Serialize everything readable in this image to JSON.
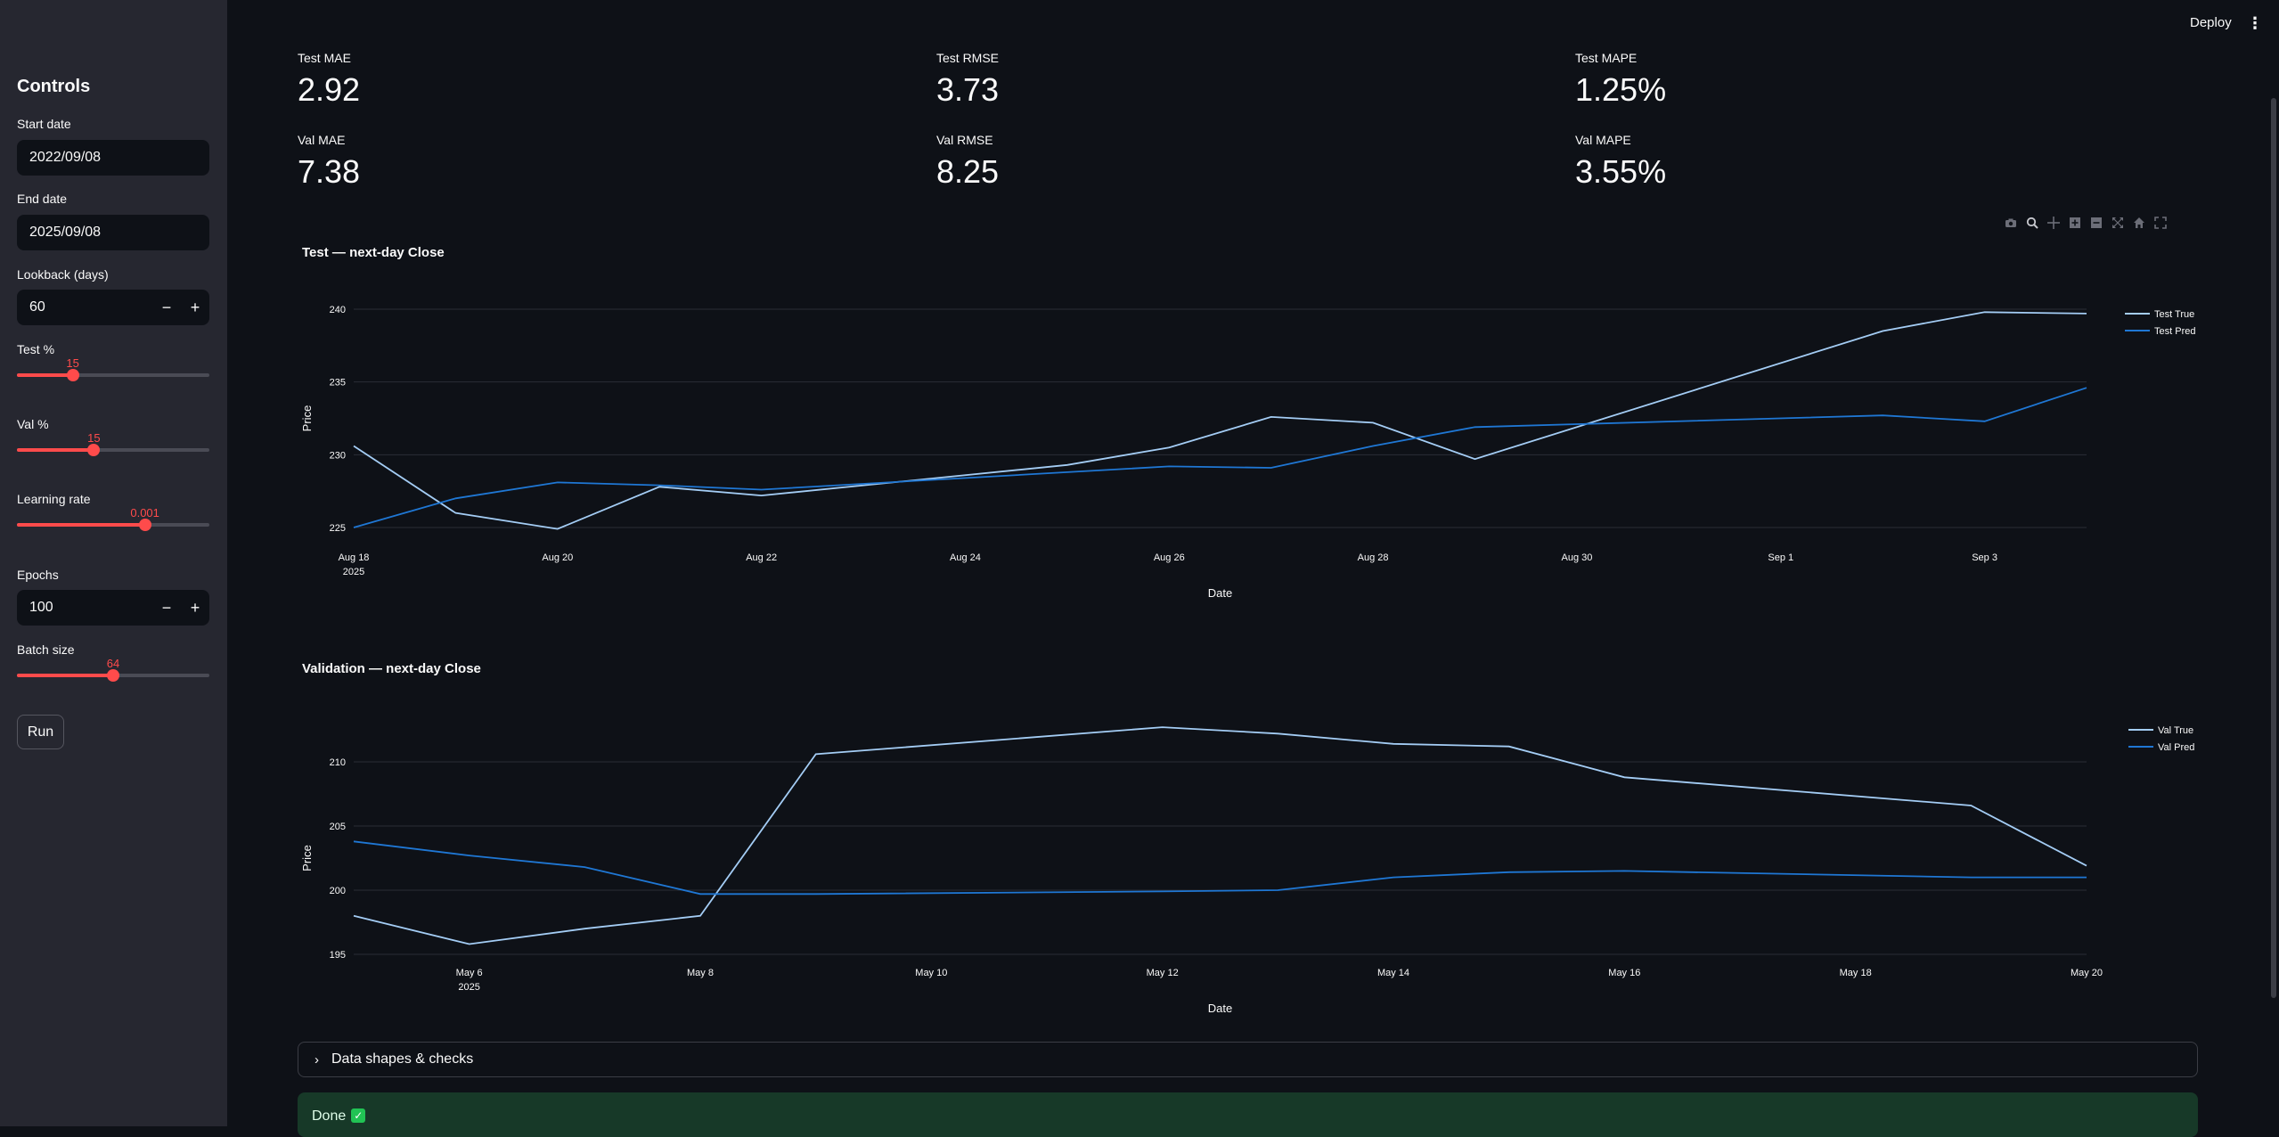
{
  "header": {
    "deploy_label": "Deploy",
    "menu_icon": "kebab-menu-icon"
  },
  "sidebar": {
    "title": "Controls",
    "start_date": {
      "label": "Start date",
      "value": "2022/09/08"
    },
    "end_date": {
      "label": "End date",
      "value": "2025/09/08"
    },
    "lookback": {
      "label": "Lookback (days)",
      "value": "60",
      "minus": "−",
      "plus": "+"
    },
    "test_pct": {
      "label": "Test %",
      "value": "15",
      "fraction": 0.29
    },
    "val_pct": {
      "label": "Val %",
      "value": "15",
      "fraction": 0.4
    },
    "learning_rate": {
      "label": "Learning rate",
      "value": "0.001",
      "fraction": 0.665
    },
    "epochs": {
      "label": "Epochs",
      "value": "100",
      "minus": "−",
      "plus": "+"
    },
    "batch_size": {
      "label": "Batch size",
      "value": "64",
      "fraction": 0.5
    },
    "run_label": "Run"
  },
  "metrics": [
    {
      "label": "Test MAE",
      "value": "2.92"
    },
    {
      "label": "Test RMSE",
      "value": "3.73"
    },
    {
      "label": "Test MAPE",
      "value": "1.25%"
    },
    {
      "label": "Val MAE",
      "value": "7.38"
    },
    {
      "label": "Val RMSE",
      "value": "8.25"
    },
    {
      "label": "Val MAPE",
      "value": "3.55%"
    }
  ],
  "chart_toolbar": [
    "camera-icon",
    "zoom-icon",
    "pan-icon",
    "zoom-in-icon",
    "zoom-out-icon",
    "autoscale-icon",
    "home-icon",
    "fullscreen-icon"
  ],
  "chart_data": [
    {
      "type": "line",
      "title": "Test — next-day Close",
      "xlabel": "Date",
      "ylabel": "Price",
      "ylim": [
        225,
        240
      ],
      "yticks": [
        225,
        230,
        235,
        240
      ],
      "xlim": [
        "2025-08-18",
        "2025-09-04"
      ],
      "xtick_labels": [
        "Aug 18",
        "Aug 20",
        "Aug 22",
        "Aug 24",
        "Aug 26",
        "Aug 28",
        "Aug 30",
        "Sep 1",
        "Sep 3"
      ],
      "xtick_year": "2025",
      "legend_position": "top-right",
      "series": [
        {
          "name": "Test True",
          "color": "#a4cdf5",
          "x": [
            "2025-08-18",
            "2025-08-19",
            "2025-08-20",
            "2025-08-21",
            "2025-08-22",
            "2025-08-25",
            "2025-08-26",
            "2025-08-27",
            "2025-08-28",
            "2025-08-29",
            "2025-09-02",
            "2025-09-03",
            "2025-09-04"
          ],
          "y": [
            230.6,
            226.0,
            224.9,
            227.8,
            227.2,
            229.3,
            230.5,
            232.6,
            232.2,
            229.7,
            238.5,
            239.8,
            239.7
          ]
        },
        {
          "name": "Test Pred",
          "color": "#1f77d4",
          "x": [
            "2025-08-18",
            "2025-08-19",
            "2025-08-20",
            "2025-08-21",
            "2025-08-22",
            "2025-08-25",
            "2025-08-26",
            "2025-08-27",
            "2025-08-28",
            "2025-08-29",
            "2025-09-02",
            "2025-09-03",
            "2025-09-04"
          ],
          "y": [
            225.0,
            227.0,
            228.1,
            227.9,
            227.6,
            228.8,
            229.2,
            229.1,
            230.6,
            231.9,
            232.7,
            232.3,
            234.6
          ]
        }
      ]
    },
    {
      "type": "line",
      "title": "Validation — next-day Close",
      "xlabel": "Date",
      "ylabel": "Price",
      "ylim": [
        195,
        210
      ],
      "yticks": [
        195,
        200,
        205,
        210
      ],
      "xlim": [
        "2025-05-05",
        "2025-05-20"
      ],
      "xtick_labels": [
        "May 6",
        "May 8",
        "May 10",
        "May 12",
        "May 14",
        "May 16",
        "May 18",
        "May 20"
      ],
      "xtick_year": "2025",
      "legend_position": "top-right",
      "series": [
        {
          "name": "Val True",
          "color": "#a4cdf5",
          "x": [
            "2025-05-05",
            "2025-05-06",
            "2025-05-07",
            "2025-05-08",
            "2025-05-09",
            "2025-05-12",
            "2025-05-13",
            "2025-05-14",
            "2025-05-15",
            "2025-05-16",
            "2025-05-19",
            "2025-05-20"
          ],
          "y": [
            198.0,
            195.8,
            197.0,
            198.0,
            210.6,
            212.7,
            212.2,
            211.4,
            211.2,
            208.8,
            206.6,
            201.9
          ]
        },
        {
          "name": "Val Pred",
          "color": "#1f77d4",
          "x": [
            "2025-05-05",
            "2025-05-06",
            "2025-05-07",
            "2025-05-08",
            "2025-05-09",
            "2025-05-12",
            "2025-05-13",
            "2025-05-14",
            "2025-05-15",
            "2025-05-16",
            "2025-05-19",
            "2025-05-20"
          ],
          "y": [
            203.8,
            202.7,
            201.8,
            199.7,
            199.7,
            199.9,
            200.0,
            201.0,
            201.4,
            201.5,
            201.0,
            201.0
          ]
        }
      ]
    }
  ],
  "expander": {
    "label": "Data shapes & checks"
  },
  "alert": {
    "text": "Done",
    "icon": "check-mark-icon"
  }
}
